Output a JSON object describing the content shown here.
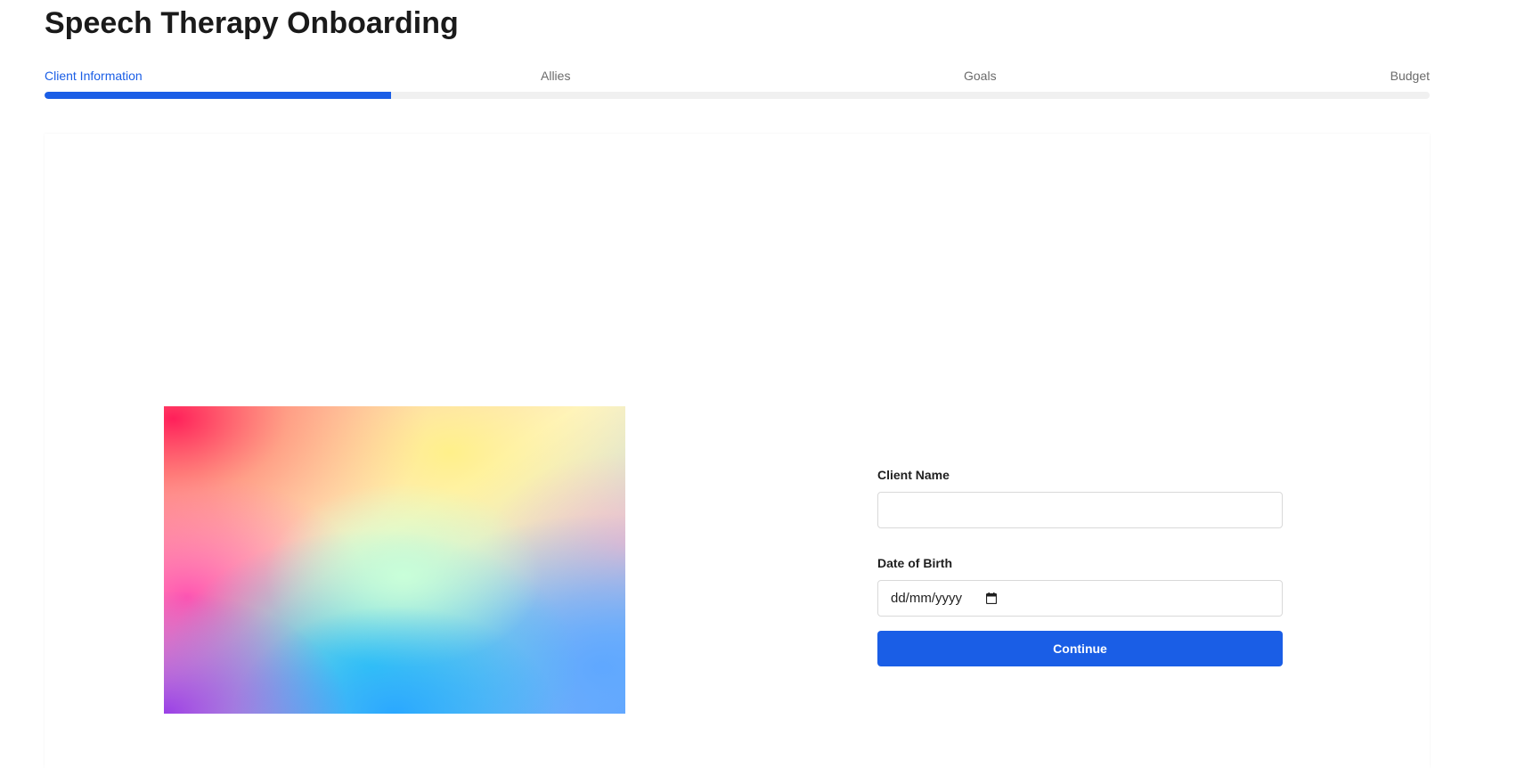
{
  "header": {
    "title": "Speech Therapy Onboarding"
  },
  "steps": [
    {
      "label": "Client Information",
      "active": true
    },
    {
      "label": "Allies",
      "active": false
    },
    {
      "label": "Goals",
      "active": false
    },
    {
      "label": "Budget",
      "active": false
    }
  ],
  "progress": {
    "fraction": 0.25,
    "color": "#1a5ee6"
  },
  "form": {
    "client_name_label": "Client Name",
    "client_name_value": "",
    "dob_label": "Date of Birth",
    "dob_placeholder": "dd/mm/yyyy",
    "calendar_icon": "calendar-icon",
    "continue_label": "Continue"
  },
  "colors": {
    "accent": "#1a5ee6",
    "inactive_step": "#6b6b6b"
  }
}
